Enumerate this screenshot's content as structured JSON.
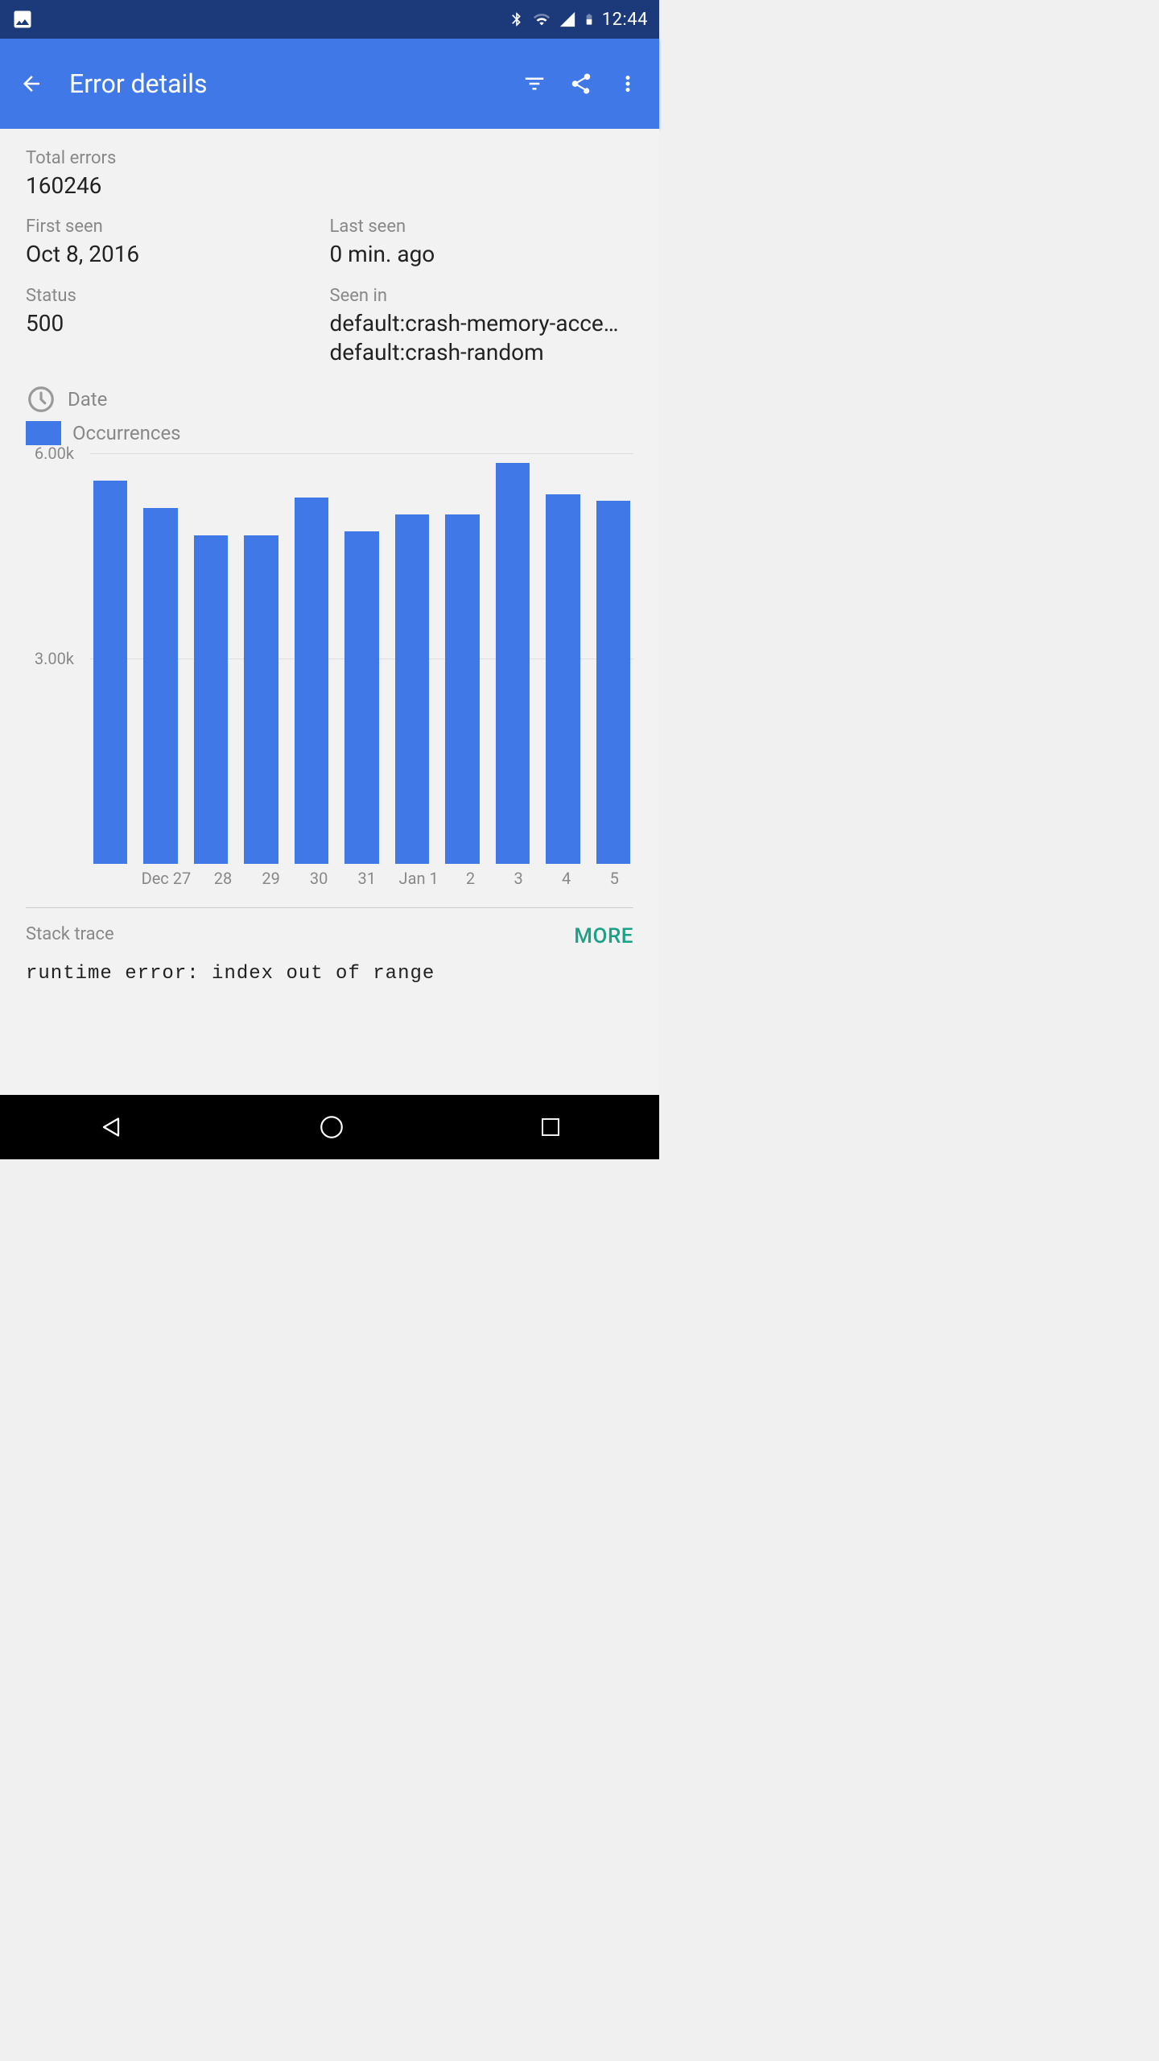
{
  "status_bar": {
    "time": "12:44"
  },
  "app_bar": {
    "title": "Error details"
  },
  "summary": {
    "total_errors": {
      "label": "Total errors",
      "value": "160246"
    },
    "first_seen": {
      "label": "First seen",
      "value": "Oct 8, 2016"
    },
    "last_seen": {
      "label": "Last seen",
      "value": "0 min. ago"
    },
    "status": {
      "label": "Status",
      "value": "500"
    },
    "seen_in": {
      "label": "Seen in",
      "line1": "default:crash-memory-acces…",
      "line2": "default:crash-random"
    }
  },
  "chart_legend": {
    "date_label": "Date",
    "occurrences_label": "Occurrences"
  },
  "chart_data": {
    "type": "bar",
    "title": "",
    "xlabel": "",
    "ylabel": "",
    "ylim": [
      0,
      6000
    ],
    "y_tick_labels": [
      "3.00k",
      "6.00k"
    ],
    "categories": [
      "Dec 27",
      "28",
      "29",
      "30",
      "31",
      "Jan 1",
      "2",
      "3",
      "4",
      "5"
    ],
    "values": [
      5600,
      5200,
      4800,
      4800,
      5350,
      4850,
      5100,
      5100,
      5850,
      5400,
      5300
    ]
  },
  "stack_trace": {
    "header": "Stack trace",
    "more": "MORE",
    "line1": "runtime error: index out of range"
  }
}
